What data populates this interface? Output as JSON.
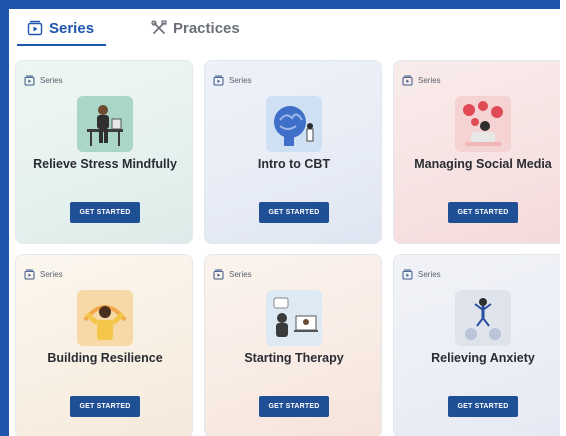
{
  "tabs": [
    {
      "label": "Series",
      "icon": "series-icon",
      "active": true
    },
    {
      "label": "Practices",
      "icon": "tools-icon",
      "active": false
    }
  ],
  "colors": {
    "accent": "#1f56ad",
    "button": "#1f4f94",
    "title": "#2a2c33"
  },
  "cards": [
    {
      "badge": "Series",
      "title": "Relieve Stress Mindfully",
      "button": "GET STARTED",
      "illustration": "person-at-desk-illustration"
    },
    {
      "badge": "Series",
      "title": "Intro to CBT",
      "button": "GET STARTED",
      "illustration": "brain-illustration"
    },
    {
      "badge": "Series",
      "title": "Managing Social Media",
      "button": "GET STARTED",
      "illustration": "social-media-illustration"
    },
    {
      "badge": "Series",
      "title": "Building Resilience",
      "button": "GET STARTED",
      "illustration": "strong-person-illustration"
    },
    {
      "badge": "Series",
      "title": "Starting Therapy",
      "button": "GET STARTED",
      "illustration": "therapy-session-illustration"
    },
    {
      "badge": "Series",
      "title": "Relieving Anxiety",
      "button": "GET STARTED",
      "illustration": "jumping-person-illustration"
    }
  ]
}
